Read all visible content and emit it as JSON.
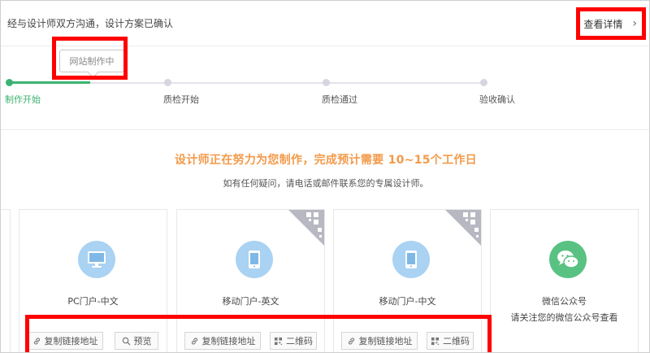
{
  "top": {
    "message": "经与设计师双方沟通，设计方案已确认",
    "detail_label": "查看详情",
    "chevron": "›"
  },
  "progress": {
    "tooltip": "网站制作中",
    "steps": [
      {
        "label": "制作开始",
        "active": true
      },
      {
        "label": "质检开始",
        "active": false
      },
      {
        "label": "质检通过",
        "active": false
      },
      {
        "label": "验收确认",
        "active": false
      }
    ]
  },
  "status": {
    "headline": "设计师正在努力为您制作，完成预计需要 10~15个工作日",
    "subline": "如有任何疑问，请电话或邮件联系您的专属设计师。"
  },
  "cards": [
    {
      "title": "PC门户-中文",
      "icon": "monitor-icon",
      "buttons": [
        "复制链接地址",
        "预览"
      ]
    },
    {
      "title": "移动门户-英文",
      "icon": "mobile-icon",
      "buttons": [
        "复制链接地址",
        "二维码"
      ]
    },
    {
      "title": "移动门户-中文",
      "icon": "mobile-icon",
      "buttons": [
        "复制链接地址",
        "二维码"
      ]
    },
    {
      "title": "微信公众号",
      "icon": "wechat-icon",
      "note": "请关注您的微信公众号查看"
    }
  ],
  "colors": {
    "accent_green": "#3cb371",
    "headline_orange": "#f39a4a",
    "icon_blue": "#a9d2f3",
    "wechat_green": "#59c282",
    "highlight_red": "#ff0000"
  }
}
